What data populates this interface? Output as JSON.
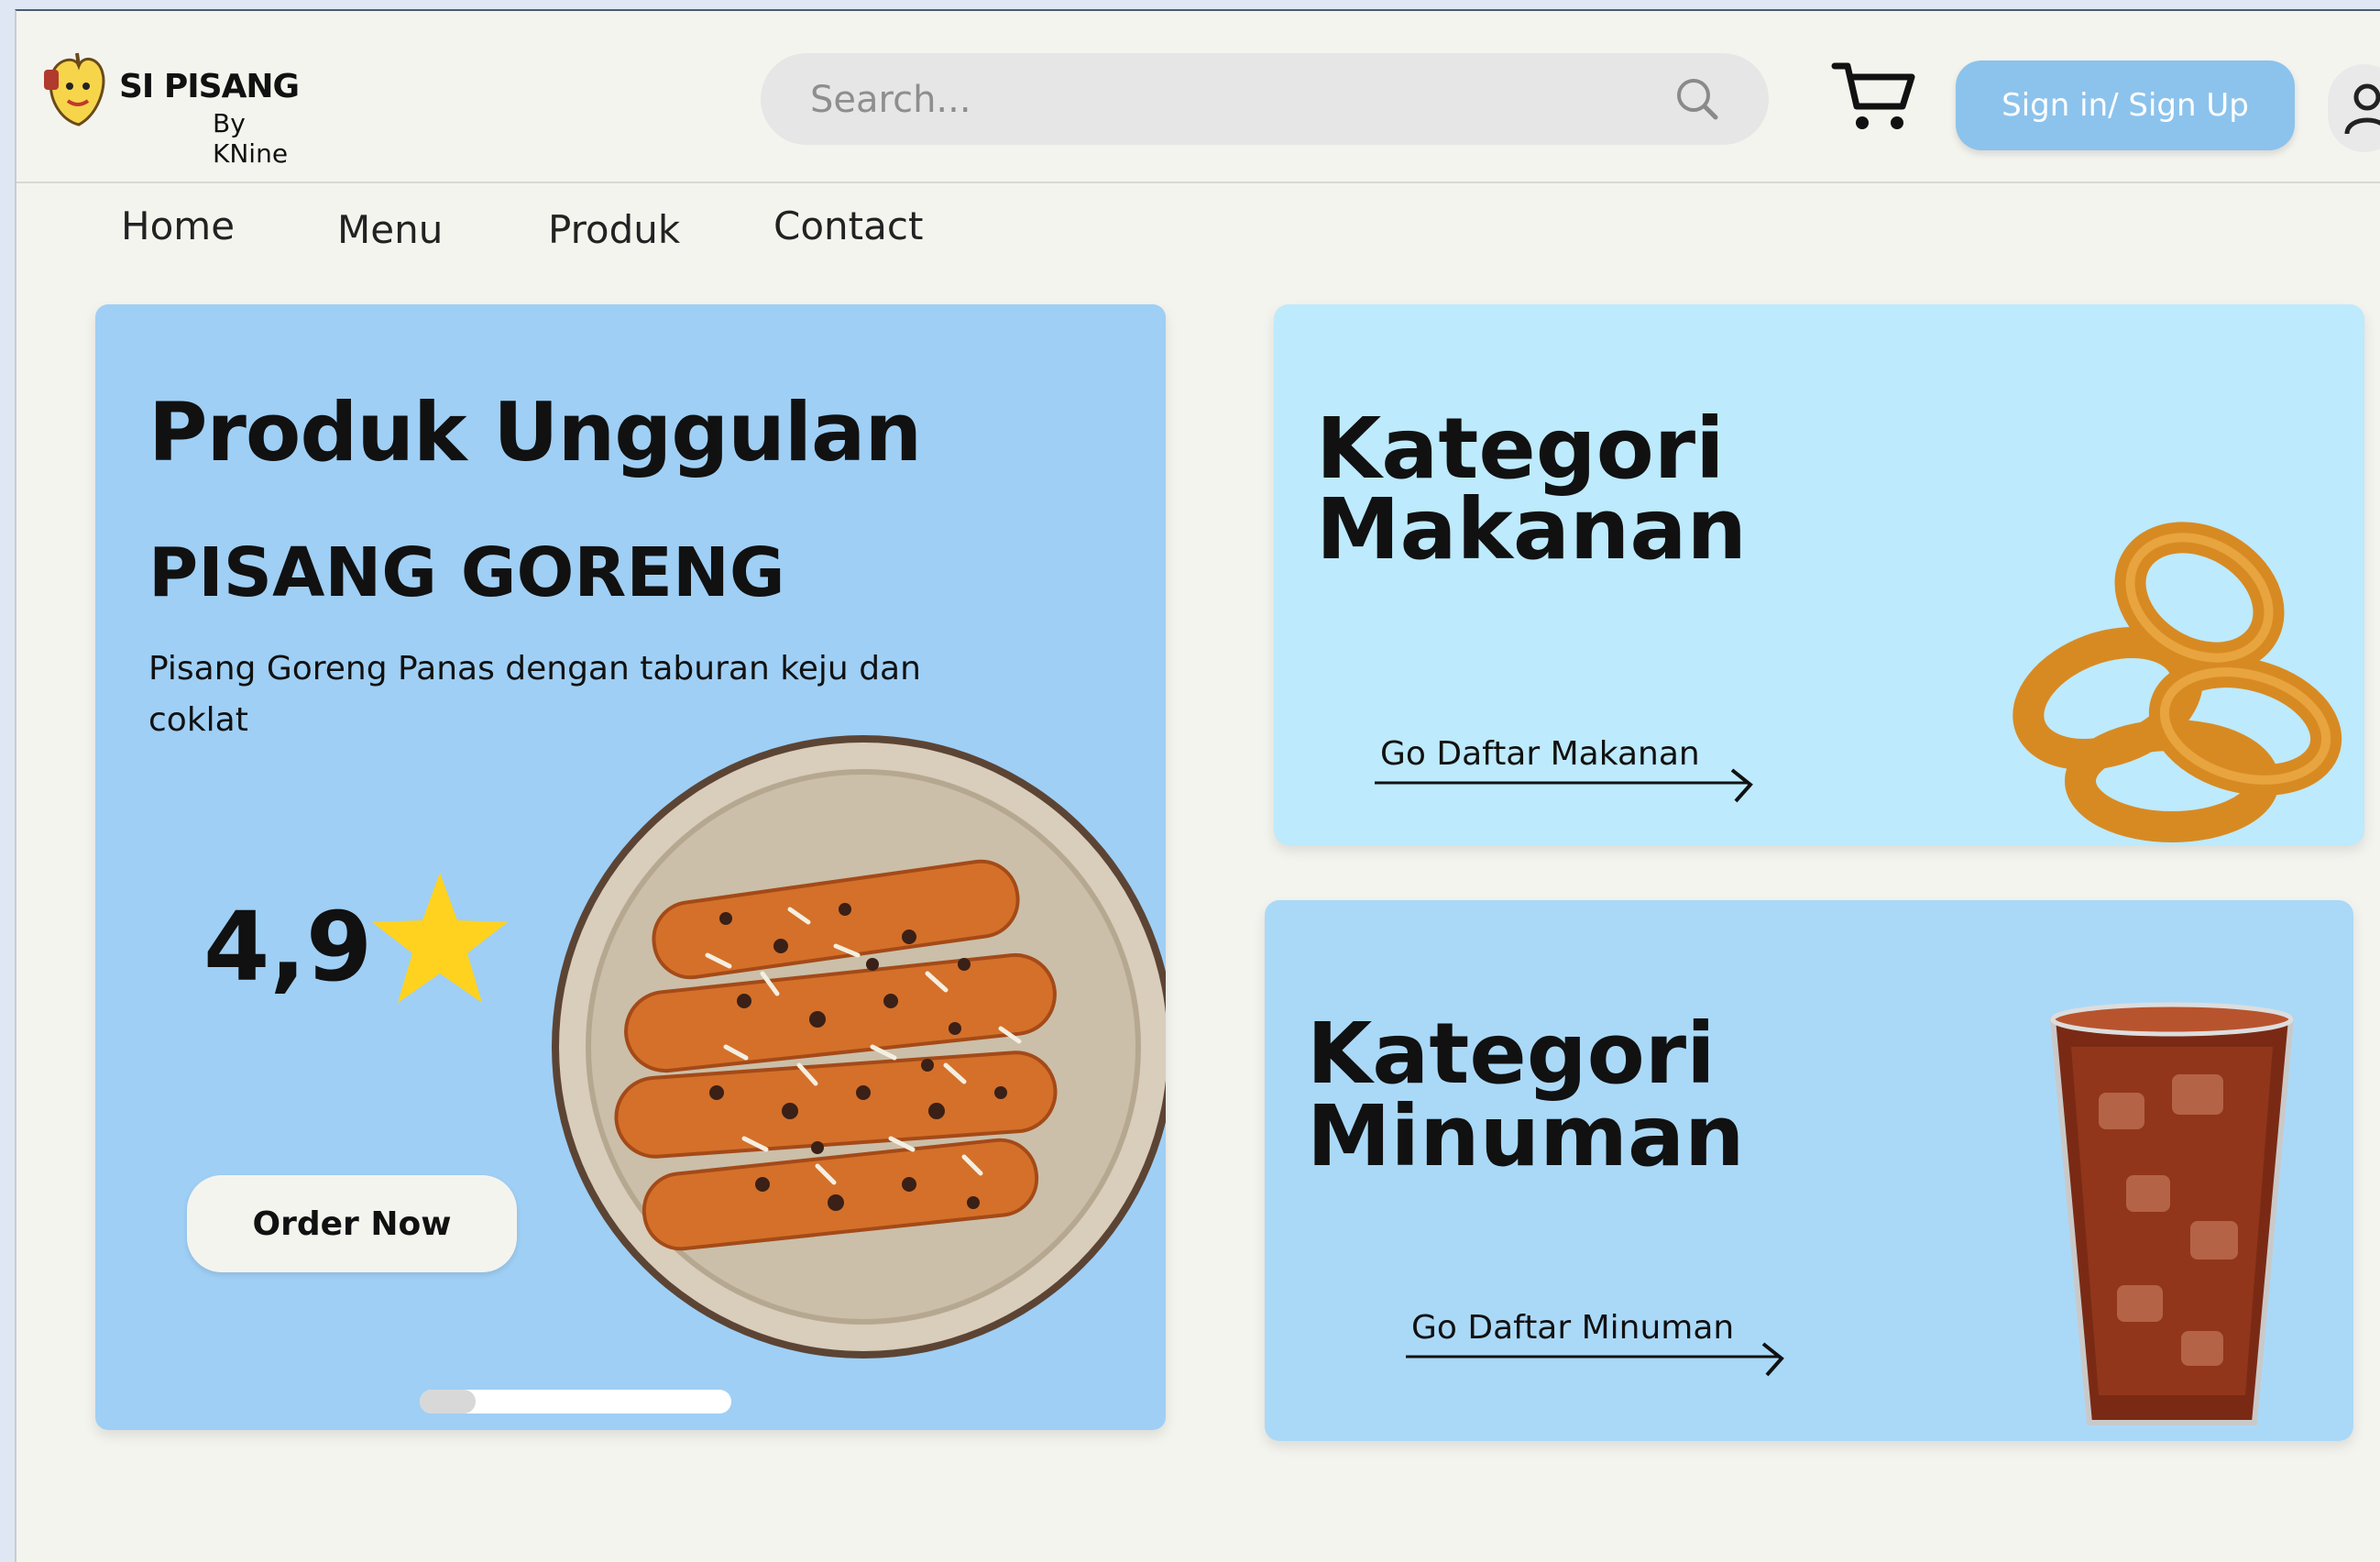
{
  "header": {
    "brand_name": "SI PISANG",
    "brand_sub": "By KNine",
    "search_placeholder": "Search...",
    "signin_label": "Sign in/ Sign Up"
  },
  "nav": {
    "items": [
      "Home",
      "Menu",
      "Produk",
      "Contact"
    ]
  },
  "hero": {
    "title": "Produk Unggulan",
    "product_name": "PISANG GORENG",
    "description": "Pisang Goreng Panas dengan taburan keju dan coklat",
    "rating": "4,9",
    "order_label": "Order Now",
    "slider_progress": 0.18
  },
  "categories": {
    "food": {
      "title_line1": "Kategori",
      "title_line2": "Makanan",
      "link": "Go Daftar Makanan"
    },
    "drink": {
      "title_line1": "Kategori",
      "title_line2": "Minuman",
      "link": "Go Daftar Minuman"
    }
  },
  "colors": {
    "accent": "#8cc3ec",
    "hero_bg": "#9fcff5",
    "food_bg": "#bdeafc",
    "drink_bg": "#aad9f8",
    "star": "#ffd21f"
  },
  "icons": [
    "banana-logo-icon",
    "search-icon",
    "cart-icon",
    "user-icon",
    "star-icon",
    "arrow-right-icon"
  ]
}
